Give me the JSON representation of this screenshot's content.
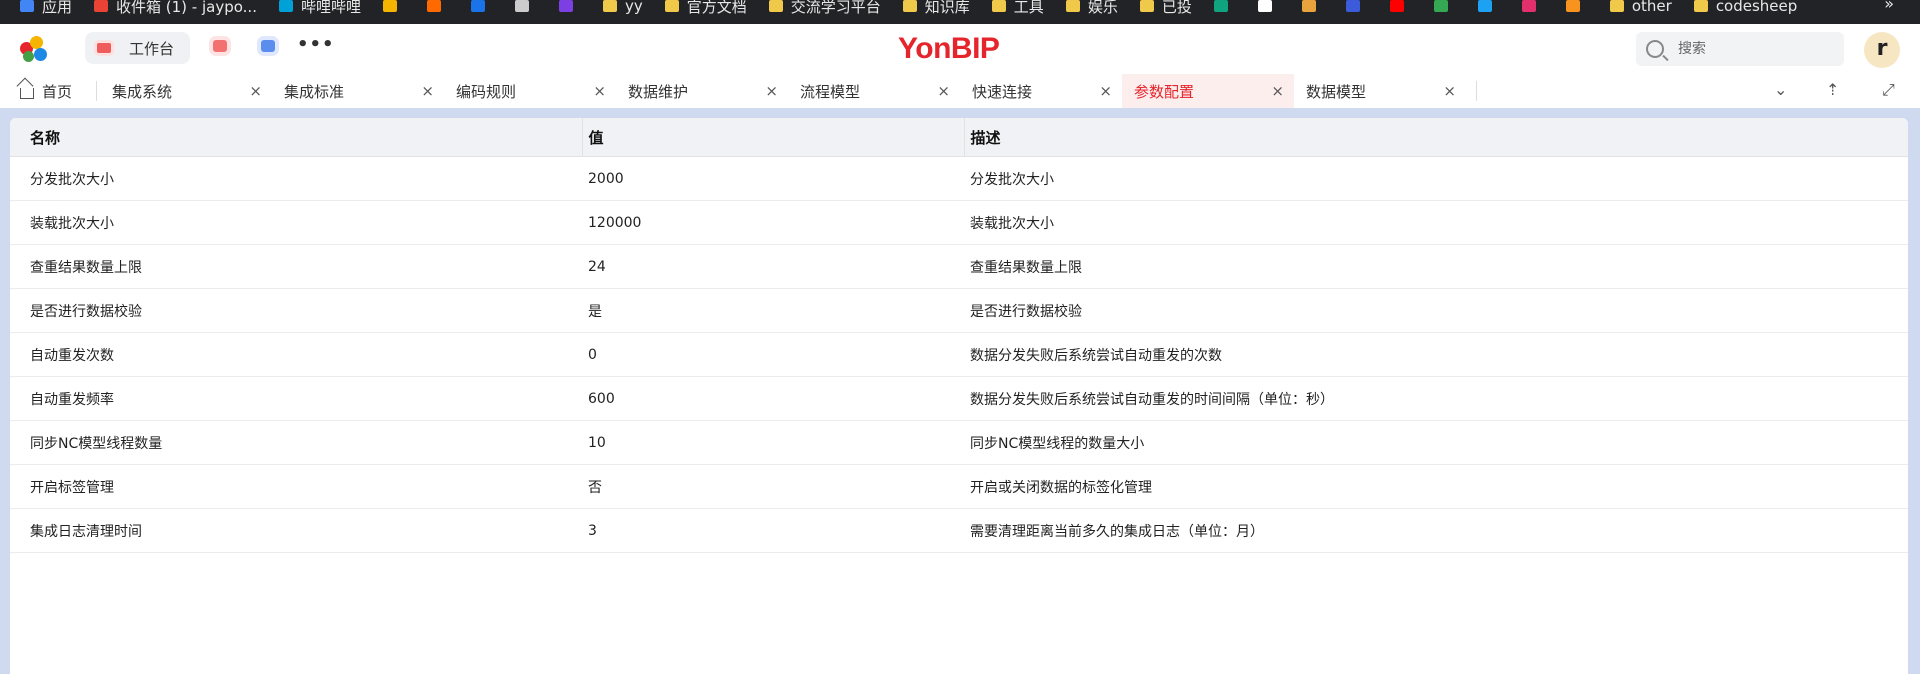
{
  "bookmarks": {
    "items": [
      {
        "label": "应用",
        "icon": "apps-grid-icon",
        "color": "#4285f4"
      },
      {
        "label": "收件箱 (1) - jaypo...",
        "icon": "gmail-icon",
        "color": "#ea4335"
      },
      {
        "label": "哔哩哔哩",
        "icon": "bilibili-icon",
        "color": "#00a1d6"
      },
      {
        "label": "",
        "icon": "extension-icon",
        "color": "#f4b400"
      },
      {
        "label": "",
        "icon": "extension-icon",
        "color": "#ff6a00"
      },
      {
        "label": "",
        "icon": "extension-icon",
        "color": "#1a73e8"
      },
      {
        "label": "",
        "icon": "extension-icon",
        "color": "#cccccc"
      },
      {
        "label": "",
        "icon": "extension-icon",
        "color": "#7b3fe4"
      },
      {
        "label": "yy",
        "icon": "folder-icon",
        "color": "#f1c94a"
      },
      {
        "label": "官方文档",
        "icon": "folder-icon",
        "color": "#f1c94a"
      },
      {
        "label": "交流学习平台",
        "icon": "folder-icon",
        "color": "#f1c94a"
      },
      {
        "label": "知识库",
        "icon": "folder-icon",
        "color": "#f1c94a"
      },
      {
        "label": "工具",
        "icon": "folder-icon",
        "color": "#f1c94a"
      },
      {
        "label": "娱乐",
        "icon": "folder-icon",
        "color": "#f1c94a"
      },
      {
        "label": "已投",
        "icon": "folder-icon",
        "color": "#f1c94a"
      },
      {
        "label": "",
        "icon": "openai-icon",
        "color": "#10a37f"
      },
      {
        "label": "",
        "icon": "extension-icon",
        "color": "#ffffff"
      },
      {
        "label": "",
        "icon": "extension-icon",
        "color": "#e8a33d"
      },
      {
        "label": "",
        "icon": "extension-icon",
        "color": "#3b5bdb"
      },
      {
        "label": "",
        "icon": "youtube-icon",
        "color": "#ff0000"
      },
      {
        "label": "",
        "icon": "extension-icon",
        "color": "#34a853"
      },
      {
        "label": "",
        "icon": "twitter-icon",
        "color": "#1da1f2"
      },
      {
        "label": "",
        "icon": "instagram-icon",
        "color": "#e1306c"
      },
      {
        "label": "",
        "icon": "extension-icon",
        "color": "#f7931e"
      },
      {
        "label": "other",
        "icon": "folder-icon",
        "color": "#f1c94a"
      },
      {
        "label": "codesheep",
        "icon": "folder-icon",
        "color": "#f1c94a"
      }
    ],
    "more": "»"
  },
  "header": {
    "workbench_label": "工作台",
    "more": "•••",
    "brand": "YonBIP",
    "search_placeholder": "搜索",
    "avatar_letter": "r"
  },
  "tabs": [
    {
      "label": "首页",
      "closable": false,
      "active": false
    },
    {
      "label": "集成系统",
      "closable": true,
      "active": false
    },
    {
      "label": "集成标准",
      "closable": true,
      "active": false
    },
    {
      "label": "编码规则",
      "closable": true,
      "active": false
    },
    {
      "label": "数据维护",
      "closable": true,
      "active": false
    },
    {
      "label": "流程模型",
      "closable": true,
      "active": false
    },
    {
      "label": "快速连接",
      "closable": true,
      "active": false
    },
    {
      "label": "参数配置",
      "closable": true,
      "active": true
    },
    {
      "label": "数据模型",
      "closable": true,
      "active": false
    }
  ],
  "tab_tools": {
    "collapse": "⌄",
    "pin": "⇡",
    "expand": "⤢",
    "close": "×"
  },
  "table": {
    "columns": [
      "名称",
      "值",
      "描述"
    ],
    "rows": [
      [
        "分发批次大小",
        "2000",
        "分发批次大小"
      ],
      [
        "装载批次大小",
        "120000",
        "装载批次大小"
      ],
      [
        "查重结果数量上限",
        "24",
        "查重结果数量上限"
      ],
      [
        "是否进行数据校验",
        "是",
        "是否进行数据校验"
      ],
      [
        "自动重发次数",
        "0",
        "数据分发失败后系统尝试自动重发的次数"
      ],
      [
        "自动重发频率",
        "600",
        "数据分发失败后系统尝试自动重发的时间间隔（单位：秒）"
      ],
      [
        "同步NC模型线程数量",
        "10",
        "同步NC模型线程的数量大小"
      ],
      [
        "开启标签管理",
        "否",
        "开启或关闭数据的标签化管理"
      ],
      [
        "集成日志清理时间",
        "3",
        "需要清理距离当前多久的集成日志（单位：月）"
      ]
    ]
  }
}
